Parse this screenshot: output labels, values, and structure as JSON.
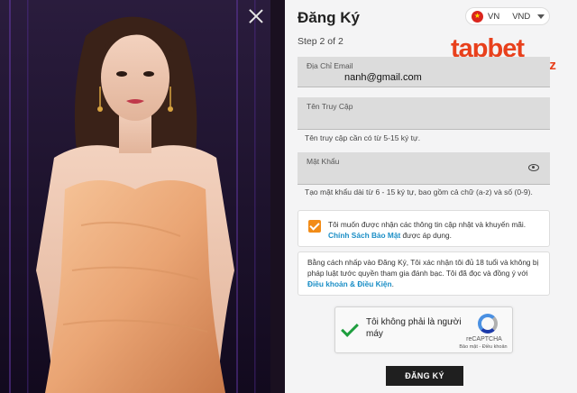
{
  "form": {
    "title": "Đăng Ký",
    "step": "Step 2 of 2",
    "email_label": "Địa Chỉ Email",
    "email_value": "nanh@gmail.com",
    "username_label": "Tên Truy Cập",
    "username_hint": "Tên truy cập cần có từ 5-15 ký tự.",
    "password_label": "Mật Khẩu",
    "password_hint": "Tạo mật khẩu dài từ 6 - 15 ký tự, bao gồm cả chữ (a-z) và số (0-9).",
    "consent_text": "Tôi muốn được nhận các thông tin cập nhật và khuyến mãi. ",
    "consent_link": "Chính Sách Bảo Mật",
    "consent_tail": " được áp dụng.",
    "consent_checked": true,
    "legal_text": "Bằng cách nhấp vào Đăng Ký, Tôi xác nhận tôi đủ 18 tuổi và không bị pháp luật tước quyền tham gia đánh bạc. Tôi đã đọc và đồng ý với ",
    "legal_link": "Điều khoản & Điều Kiện",
    "legal_tail": ".",
    "submit_label": "ĐĂNG KÝ"
  },
  "locale": {
    "language": "VN",
    "currency": "VND"
  },
  "brand": {
    "name": "tapbet",
    "suffix": "biz",
    "color": "#e8401c"
  },
  "captcha": {
    "text": "Tôi không phải là người máy",
    "brand": "reCAPTCHA",
    "links": "Bảo mật - Điều khoản",
    "checked": true
  },
  "icons": {
    "close": "close-icon",
    "eye": "eye-icon",
    "flag": "vietnam-flag-icon",
    "chevron": "chevron-down-icon"
  }
}
